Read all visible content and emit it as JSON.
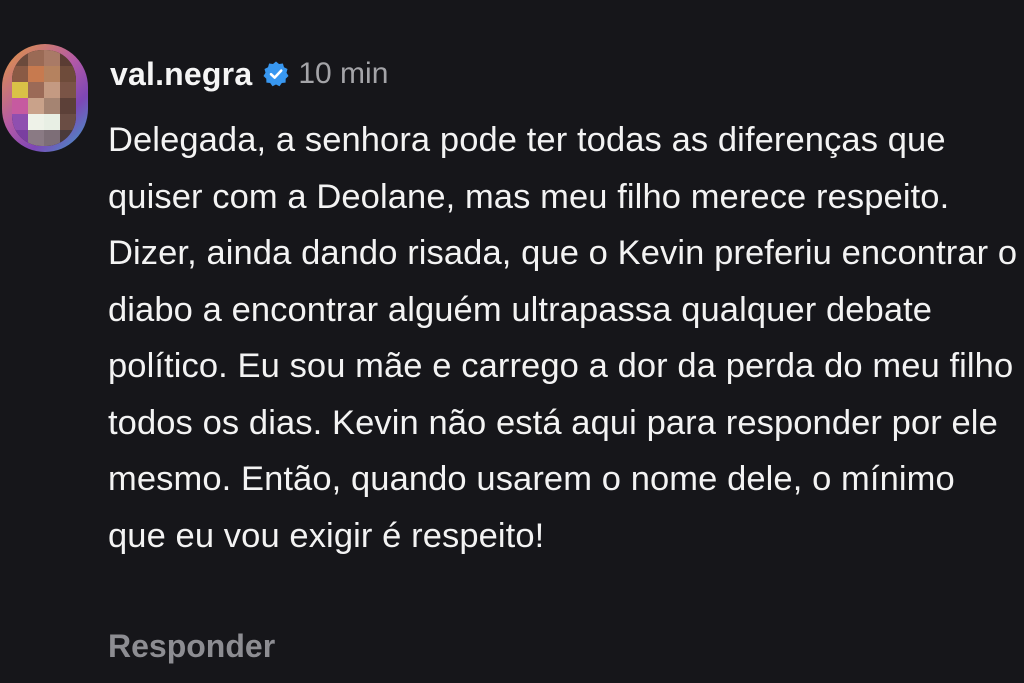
{
  "comment": {
    "username": "val.negra",
    "verified_icon": "verified-badge-icon",
    "time_ago": "10 min",
    "text": "Delegada, a senhora pode ter todas as diferenças que quiser com a Deolane, mas meu filho merece respeito. Dizer, ainda dando risada, que o Kevin preferiu encontrar o diabo a encontrar alguém ultrapassa qualquer debate político. Eu sou mãe e carrego a dor da perda do meu filho todos os dias. Kevin não está aqui para responder por ele mesmo. Então, quando usarem o nome dele, o mínimo que eu vou exigir é respeito!",
    "reply_label": "Responder"
  },
  "colors": {
    "background": "#16161a",
    "verified_badge": "#3897f0",
    "muted_text": "#8d8d92"
  }
}
